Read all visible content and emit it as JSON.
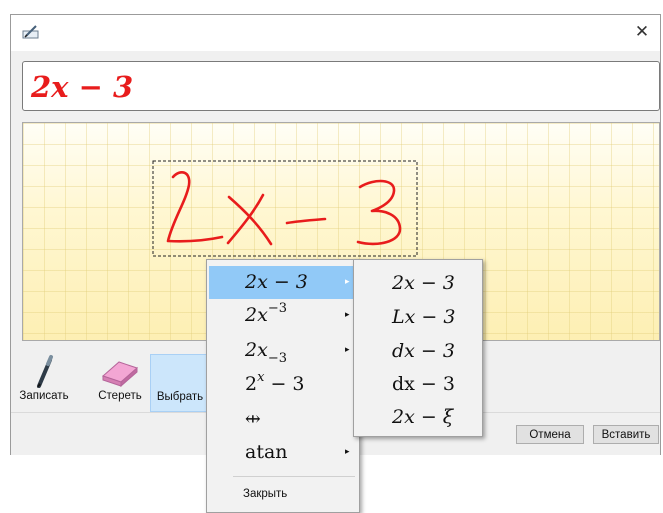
{
  "window": {
    "close_glyph": "✕",
    "icon": "pen-tablet-icon"
  },
  "preview": {
    "expression": "2x − 3",
    "color": "#e81c1c"
  },
  "canvas": {
    "background": "#fdf5c7",
    "ink_color": "#e81c1c",
    "selection_border": "dashed",
    "handwriting": "2x − 3"
  },
  "toolbar": {
    "write_label": "Записать",
    "erase_label": "Стереть",
    "select_label": "Выбрать",
    "selected_tool": "select"
  },
  "footer": {
    "cancel_label": "Отмена",
    "insert_label": "Вставить"
  },
  "menu": {
    "highlight_color": "#91c9f7",
    "items": [
      {
        "base": "2x − 3",
        "has_submenu": true,
        "highlighted": true
      },
      {
        "base": "2x",
        "sup": "−3",
        "has_submenu": true
      },
      {
        "base": "2x",
        "sub": "−3",
        "has_submenu": true
      },
      {
        "base": "2",
        "sup": "x",
        "tail": " − 3",
        "has_submenu": false
      },
      {
        "base": "⇹",
        "has_submenu": false
      },
      {
        "base": "atan",
        "has_submenu": true
      }
    ],
    "close_label": "Закрыть",
    "arrow_glyph": "▸"
  },
  "submenu": {
    "items": [
      "2x − 3",
      "Lx − 3",
      "dx − 3",
      "dx − 3",
      "2x − ξ"
    ]
  }
}
